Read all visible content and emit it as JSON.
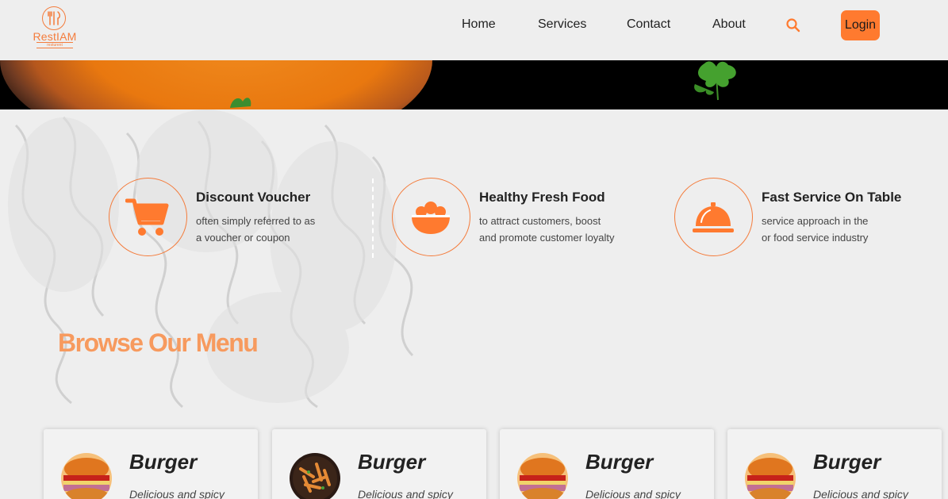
{
  "logo": {
    "name": "RestIAM",
    "tagline": "resturent"
  },
  "nav": {
    "items": [
      "Home",
      "Services",
      "Contact",
      "About"
    ],
    "login": "Login"
  },
  "colors": {
    "accent": "#ff7a2f",
    "accent_soft": "#f79a5e",
    "background": "#eeeeee"
  },
  "features": [
    {
      "title": "Discount Voucher",
      "line1": "often simply referred to as",
      "line2": "a voucher or coupon",
      "icon": "shopping-cart-icon"
    },
    {
      "title": "Healthy Fresh Food",
      "line1": "to attract customers, boost",
      "line2": "and promote customer loyalty",
      "icon": "food-bowl-icon"
    },
    {
      "title": "Fast Service On Table",
      "line1": "service approach in the",
      "line2": "or food service industry",
      "icon": "serving-bell-icon"
    }
  ],
  "menu": {
    "title": "Browse Our Menu",
    "cards": [
      {
        "title": "Burger",
        "desc": "Delicious and spicy",
        "image": "burger"
      },
      {
        "title": "Burger",
        "desc": "Delicious and spicy",
        "image": "pasta"
      },
      {
        "title": "Burger",
        "desc": "Delicious and spicy",
        "image": "burger"
      },
      {
        "title": "Burger",
        "desc": "Delicious and spicy",
        "image": "burger"
      }
    ]
  }
}
